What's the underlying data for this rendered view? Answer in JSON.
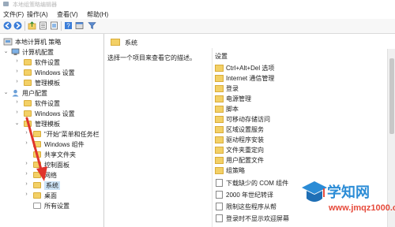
{
  "window": {
    "title": "本地组策略编辑器"
  },
  "menu": [
    "文件(F)",
    "操作(A)",
    "查看(V)",
    "帮助(H)"
  ],
  "tree": {
    "root": "本地计算机 策略",
    "computer_config": "计算机配置",
    "computer_children": [
      "软件设置",
      "Windows 设置",
      "管理模板"
    ],
    "user_config": "用户配置",
    "user_children": [
      "软件设置",
      "Windows 设置",
      "管理模板"
    ],
    "admin_children": [
      "\"开始\"菜单和任务栏",
      "Windows 组件",
      "共享文件夹",
      "控制面板",
      "网络",
      "系统",
      "桌面",
      "所有设置"
    ],
    "selected": "系统"
  },
  "right": {
    "header": "系统",
    "hint": "选择一个项目来查看它的描述。",
    "column_header": "设置",
    "folders": [
      "Ctrl+Alt+Del 选项",
      "Internet 通信管理",
      "登录",
      "电源管理",
      "脚本",
      "可移动存储访问",
      "区域设置服务",
      "驱动程序安装",
      "文件夹重定向",
      "用户配置文件",
      "组策略"
    ],
    "policies": [
      "下载缺少的 COM 组件",
      "2000 年世纪转译",
      "限制这些程序从帮",
      "登录时不显示欢迎屏幕"
    ]
  },
  "watermark": {
    "text": "学知网",
    "url": "www.jmqz1000.com"
  },
  "colors": {
    "folder": "#f3d066",
    "selection": "#cde4f7",
    "watermark_blue": "#2b8cd6",
    "watermark_red": "#e64a3b",
    "arrow": "#e0342b"
  }
}
